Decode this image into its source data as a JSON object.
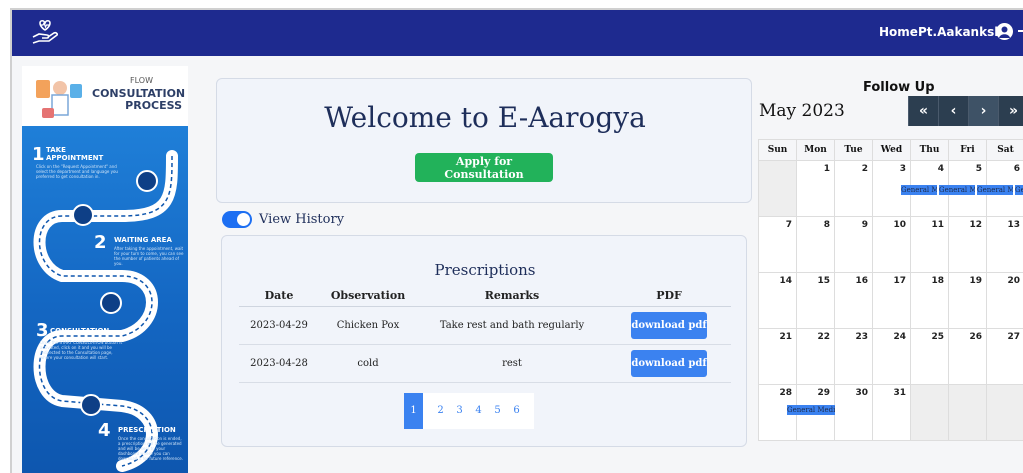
{
  "navbar": {
    "home_label": "Home",
    "user_label": "Pt.Aakanksha"
  },
  "infographic": {
    "flow_label": "FLOW",
    "title": "CONSULTATION PROCESS",
    "steps": [
      {
        "num": "1",
        "label": "TAKE APPOINTMENT",
        "text": "Click on the \"Request Appointment\" and select the department and language you preferred to get consultation in."
      },
      {
        "num": "2",
        "label": "WAITING AREA",
        "text": "After taking the appointment, wait for your turn to come, you can see the number of patients ahead of you."
      },
      {
        "num": "3",
        "label": "CONSULTATION",
        "text": "Once the START CONSULTATION button is activated, click on it and you will be redirected to the Consultation page, where your consultation will start."
      },
      {
        "num": "4",
        "label": "PRESCRIPTION",
        "text": "Once the consultation is ended, a prescription will be generated and will be sent to your dashboard where you can download it for future reference."
      }
    ]
  },
  "welcome": {
    "title": "Welcome to E-Aarogya",
    "apply_label": "Apply for Consultation"
  },
  "history": {
    "toggle_label": "View History"
  },
  "prescriptions": {
    "title": "Prescriptions",
    "headers": [
      "Date",
      "Observation",
      "Remarks",
      "PDF"
    ],
    "rows": [
      {
        "date": "2023-04-29",
        "observation": "Chicken Pox",
        "remarks": "Take rest and bath regularly",
        "pdf_label": "download pdf"
      },
      {
        "date": "2023-04-28",
        "observation": "cold",
        "remarks": "rest",
        "pdf_label": "download pdf"
      }
    ],
    "pages": [
      "1",
      "2",
      "3",
      "4",
      "5",
      "6"
    ],
    "active_page": "1"
  },
  "calendar": {
    "title": "Follow Up",
    "month": "May 2023",
    "nav": [
      "«",
      "‹",
      "›",
      "»"
    ],
    "weekdays": [
      "Sun",
      "Mon",
      "Tue",
      "Wed",
      "Thu",
      "Fri",
      "Sat"
    ],
    "weeks": [
      [
        "",
        "1",
        "2",
        "3",
        "4",
        "5",
        "6"
      ],
      [
        "7",
        "8",
        "9",
        "10",
        "11",
        "12",
        "13"
      ],
      [
        "14",
        "15",
        "16",
        "17",
        "18",
        "19",
        "20"
      ],
      [
        "21",
        "22",
        "23",
        "24",
        "25",
        "26",
        "27"
      ],
      [
        "28",
        "29",
        "30",
        "31",
        "",
        "",
        ""
      ]
    ],
    "event_label": "General Medic"
  },
  "colors": {
    "navbar": "#1e2a8f",
    "primary": "#3b82f0",
    "success": "#22b25a"
  }
}
